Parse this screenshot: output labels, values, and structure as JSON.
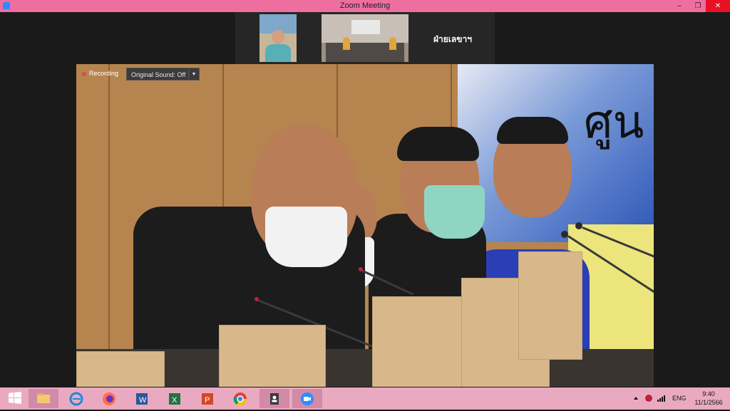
{
  "window": {
    "title": "Zoom Meeting",
    "title_bar_color": "#ef6ea0",
    "controls": {
      "minimize": "–",
      "restore": "❐",
      "close": "✕"
    }
  },
  "gallery": {
    "participants": [
      {
        "name": "",
        "type": "person-tile"
      },
      {
        "name": "",
        "type": "room-tile"
      }
    ],
    "active_label": "ฝ่ายเลขาฯ"
  },
  "main_video": {
    "recording_label": "Recording",
    "original_sound_label": "Original Sound: Off",
    "banner_text": "ศูน"
  },
  "taskbar": {
    "apps": [
      {
        "name": "windows-start",
        "icon": "windows-logo-icon"
      },
      {
        "name": "file-explorer",
        "icon": "folder-icon"
      },
      {
        "name": "internet-explorer",
        "icon": "ie-icon"
      },
      {
        "name": "firefox",
        "icon": "firefox-icon"
      },
      {
        "name": "word",
        "icon": "word-icon"
      },
      {
        "name": "excel",
        "icon": "excel-icon"
      },
      {
        "name": "powerpoint",
        "icon": "powerpoint-icon"
      },
      {
        "name": "chrome",
        "icon": "chrome-icon"
      },
      {
        "name": "contacts",
        "icon": "contacts-icon"
      },
      {
        "name": "zoom",
        "icon": "zoom-icon"
      }
    ],
    "tray": {
      "language": "ENG",
      "time": "9:40",
      "date": "11/1/2566"
    }
  }
}
